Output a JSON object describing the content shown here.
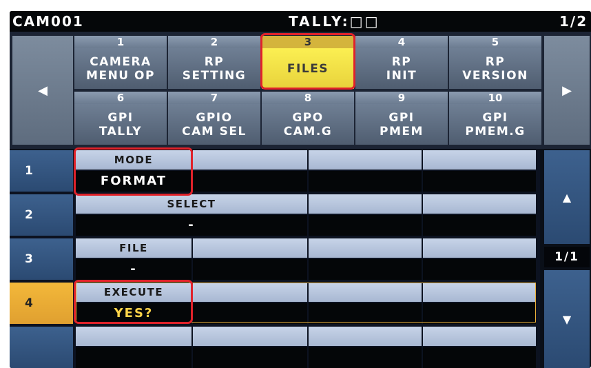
{
  "header": {
    "camera_id": "CAM001",
    "tally": "TALLY:□□",
    "page": "1/2"
  },
  "nav": {
    "left_icon": "left-triangle-icon",
    "right_icon": "right-triangle-icon"
  },
  "menu": [
    {
      "num": "1",
      "line1": "CAMERA",
      "line2": "MENU OP"
    },
    {
      "num": "2",
      "line1": "RP",
      "line2": "SETTING"
    },
    {
      "num": "3",
      "line1": "FILES",
      "line2": ""
    },
    {
      "num": "4",
      "line1": "RP",
      "line2": "INIT"
    },
    {
      "num": "5",
      "line1": "RP",
      "line2": "VERSION"
    },
    {
      "num": "6",
      "line1": "GPI",
      "line2": "TALLY"
    },
    {
      "num": "7",
      "line1": "GPIO",
      "line2": "CAM SEL"
    },
    {
      "num": "8",
      "line1": "GPO",
      "line2": "CAM.G"
    },
    {
      "num": "9",
      "line1": "GPI",
      "line2": "PMEM"
    },
    {
      "num": "10",
      "line1": "GPI",
      "line2": "PMEM.G"
    }
  ],
  "selected_menu": "FILES",
  "rows": [
    {
      "num": "1",
      "label": "MODE",
      "value": "FORMAT"
    },
    {
      "num": "2",
      "label": "SELECT",
      "value": "-"
    },
    {
      "num": "3",
      "label": "FILE",
      "value": "-"
    },
    {
      "num": "4",
      "label": "EXECUTE",
      "value": "YES?"
    }
  ],
  "scroll": {
    "up_icon": "up-triangle-icon",
    "page": "1/1",
    "down_icon": "down-triangle-icon"
  },
  "colors": {
    "selected_menu": "#f6e64a",
    "active_row": "#f0b43a",
    "highlight": "#e0222a"
  }
}
